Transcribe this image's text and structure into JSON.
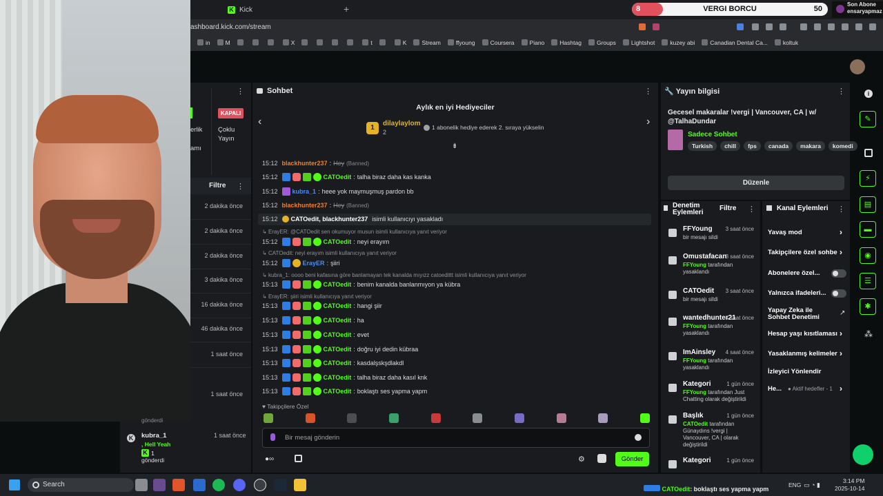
{
  "browser": {
    "tab_title": "Kick",
    "url": "ashboard.kick.com/stream",
    "bookmarks": [
      "in",
      "M",
      "",
      "",
      "",
      "X",
      "",
      "",
      "",
      "",
      "t",
      "",
      "K",
      "Stream",
      "ffyoung",
      "Coursera",
      "Piano",
      "Hashtag",
      "Groups",
      "Lightshot",
      "kuzey abi",
      "Canadian Dental Ca...",
      "koltuk"
    ]
  },
  "goal_overlay": {
    "left_value": "8",
    "title": "VERGI BORCU",
    "right_value": "50",
    "progress_fraction": 0.16
  },
  "last_sub": {
    "label": "Son Abone",
    "name": "ensaryapmaz"
  },
  "left_panel": {
    "status_badge": "KAPALI",
    "status_label": "Çoklu Yayın",
    "partial_text_1": "erlik",
    "partial_text_2": "amı",
    "filter_label": "Filtre",
    "times": [
      "2 dakika önce",
      "2 dakika önce",
      "2 dakika önce",
      "3 dakika önce",
      "16 dakika önce",
      "46 dakika önce",
      "1 saat önce",
      "1 saat önce"
    ],
    "partial_gift_top": "gönderdi",
    "last_item": {
      "user": "kubra_1",
      "message": ", Hell Yeah",
      "count": "1",
      "suffix": "gönderdi",
      "time": "1 saat önce"
    }
  },
  "chat": {
    "title": "Sohbet",
    "top_gifters_title": "Aylık en iyi Hediyeciler",
    "gifter": {
      "rank": "1",
      "name": "dilaylaylom",
      "count": "2",
      "info": "1 abonelik hediye ederek 2. sıraya yükselin"
    },
    "messages": [
      {
        "time": "15:12",
        "user": "blackhunter237",
        "text": "Hey",
        "note": "(Banned)",
        "type": "banned"
      },
      {
        "time": "15:12",
        "user": "CATOedit",
        "text": "talha biraz daha kas kanka",
        "type": "mod"
      },
      {
        "time": "15:12",
        "user": "kubra_1",
        "text": "heee yok maymuşmuş pardon bb",
        "type": "sub"
      },
      {
        "time": "15:12",
        "user": "blackhunter237",
        "text": "Hey",
        "note": "(Banned)",
        "type": "banned"
      },
      {
        "time": "15:12",
        "user": "CATOedit, blackhunter237",
        "text": "isimli kullanıcıyı yasakladı",
        "type": "system"
      },
      {
        "reply": "ErayER: @CATOedit sen okumuyor musun isimli kullanıcıya yanıt veriyor",
        "time": "15:12",
        "user": "CATOedit",
        "text": "neyi erayım",
        "type": "mod"
      },
      {
        "reply": "CATOedit: neyi erayım isimli kullanıcıya yanıt veriyor",
        "time": "15:12",
        "user": "ErayER",
        "text": "şiiri",
        "type": "gold"
      },
      {
        "reply": "kubra_1: oooo beni kafasına göre banlamayan tek kanalda mıyızz catoedittt isimli kullanıcıya yanıt veriyor",
        "time": "15:13",
        "user": "CATOedit",
        "text": "benim kanalda banlanmıyon ya kübra",
        "type": "mod"
      },
      {
        "reply": "ErayER: şiiri isimli kullanıcıya yanıt veriyor",
        "time": "15:13",
        "user": "CATOedit",
        "text": "hangi şiir",
        "type": "mod"
      },
      {
        "time": "15:13",
        "user": "CATOedit",
        "text": "ha",
        "type": "mod"
      },
      {
        "time": "15:13",
        "user": "CATOedit",
        "text": "evet",
        "type": "mod"
      },
      {
        "time": "15:13",
        "user": "CATOedit",
        "text": "doğru iyi dedin kübraa",
        "type": "mod"
      },
      {
        "time": "15:13",
        "user": "CATOedit",
        "text": "kasdalşskşdlakdl",
        "type": "mod"
      },
      {
        "time": "15:13",
        "user": "CATOedit",
        "text": "talha biraz daha kasıl knk",
        "type": "mod"
      },
      {
        "time": "15:13",
        "user": "CATOedit",
        "text": "boklaştı ses yapma yapm",
        "type": "mod"
      }
    ],
    "subscribers_only_label": "Takipçilere Özel",
    "input_placeholder": "Bir mesaj gönderin",
    "send_label": "Gönder"
  },
  "stream_info": {
    "title": "Yayın bilgisi",
    "stream_title": "Gecesel makaralar !vergi | Vancouver, CA | w/ @TalhaDundar",
    "category": "Sadece Sohbet",
    "tags": [
      "Turkish",
      "chill",
      "fps",
      "canada",
      "makara",
      "komedi"
    ],
    "edit_label": "Düzenle"
  },
  "mod_log": {
    "title": "Denetim Eylemleri",
    "filter_label": "Filtre",
    "items": [
      {
        "user": "FFYoung",
        "pre": "",
        "desc": "bir mesajı sildi",
        "time": "3 saat önce"
      },
      {
        "user": "Omustafacan",
        "pre": "FFYoung",
        "desc": "tarafından yasaklandı",
        "time": "3 saat önce"
      },
      {
        "user": "CATOedit",
        "pre": "",
        "desc": "bir mesajı sildi",
        "time": "3 saat önce"
      },
      {
        "user": "wantedhunter21",
        "pre": "FFYoung",
        "desc": "tarafından yasaklandı",
        "time": "4 saat önce"
      },
      {
        "user": "ImAinsley",
        "pre": "FFYoung",
        "desc": "tarafından yasaklandı",
        "time": "4 saat önce"
      },
      {
        "user": "Kategori",
        "pre": "FFYoung",
        "desc": "tarafından Just Chatting olarak değiştirildi",
        "time": "1 gün önce"
      },
      {
        "user": "Başlık",
        "pre": "CATOedit",
        "desc": "tarafından Günaydıns !vergi | Vancouver, CA | olarak değiştirildi",
        "time": "1 gün önce"
      },
      {
        "user": "Kategori",
        "pre": "",
        "desc": "",
        "time": "1 gün önce"
      }
    ]
  },
  "channel_actions": {
    "title": "Kanal Eylemleri",
    "items": [
      {
        "label": "Yavaş mod",
        "kind": "chevron"
      },
      {
        "label": "Takipçilere özel sohbe",
        "kind": "chevron"
      },
      {
        "label": "Abonelere özel...",
        "kind": "toggle"
      },
      {
        "label": "Yalnızca ifadeleri...",
        "kind": "toggle"
      },
      {
        "label": "Yapay Zeka ile Sohbet Denetimi",
        "kind": "link"
      },
      {
        "label": "Hesap yaşı kısıtlaması",
        "kind": "chevron"
      },
      {
        "label": "Yasaklanmış kelimeler",
        "kind": "chevron"
      },
      {
        "label": "İzleyici Yönlendir",
        "kind": "none"
      },
      {
        "label": "He...",
        "kind": "chevron",
        "extra": "Aktif hedefler - 1"
      }
    ]
  },
  "taskbar": {
    "search_label": "Search",
    "ticker_user": "CATOedit",
    "ticker_text": ": boklaştı ses yapma yapm",
    "lang": "ENG",
    "time": "3:14 PM",
    "date": "2025-10-14"
  },
  "colors": {
    "accent": "#53fc18",
    "panel": "#191b1f",
    "bg": "#0b0e0f",
    "goal_red": "#e0515d"
  }
}
